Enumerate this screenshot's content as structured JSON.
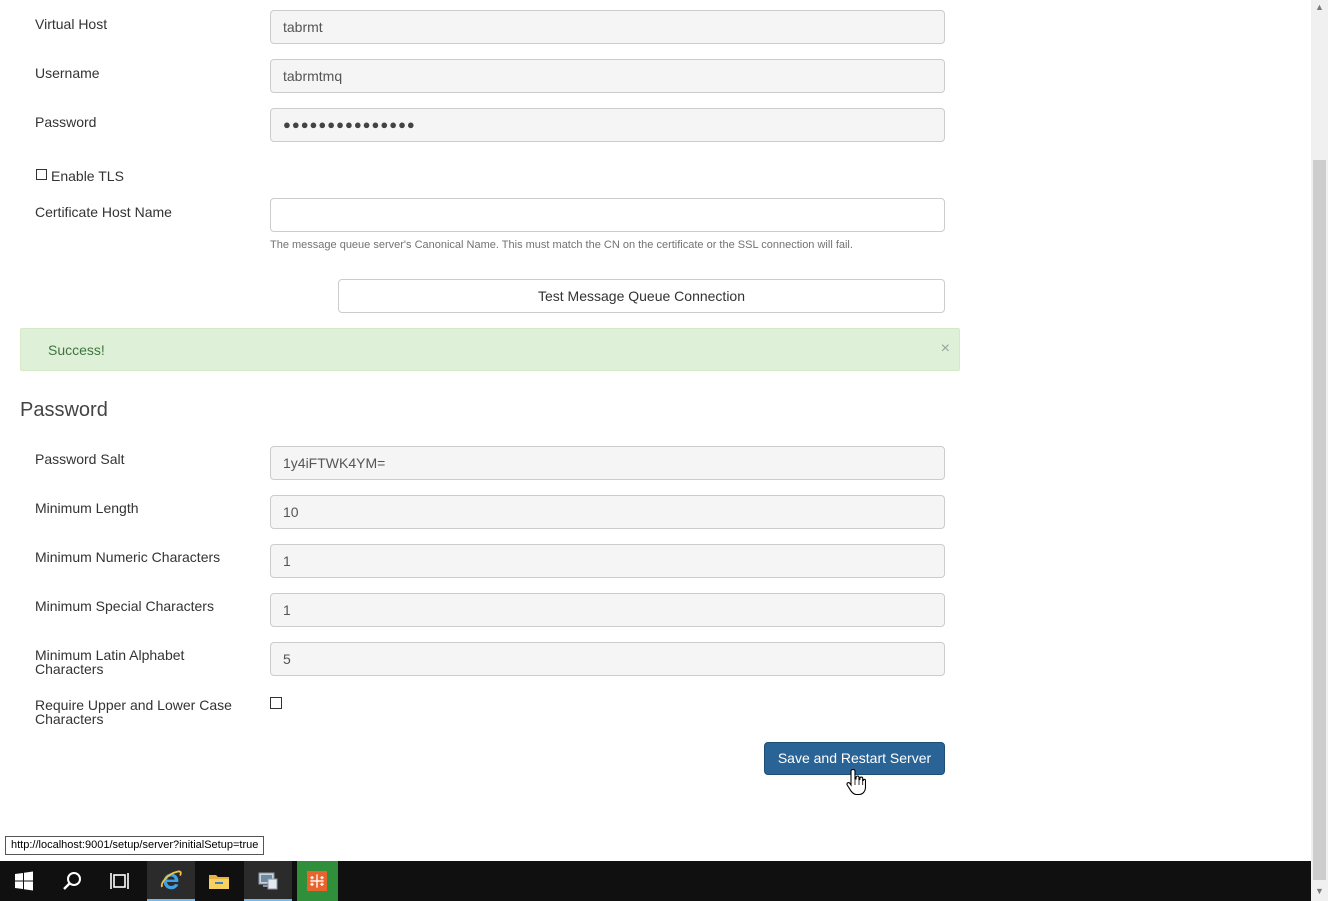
{
  "form": {
    "virtual_host": {
      "label": "Virtual Host",
      "value": "tabrmt"
    },
    "username": {
      "label": "Username",
      "value": "tabrmtmq"
    },
    "password": {
      "label": "Password",
      "value": "●●●●●●●●●●●●●●●"
    },
    "enable_tls": {
      "label": "Enable TLS",
      "checked": false
    },
    "certificate_host_name": {
      "label": "Certificate Host Name",
      "value": "",
      "help": "The message queue server's Canonical Name. This must match the CN on the certificate or the SSL connection will fail."
    },
    "test_button": "Test Message Queue Connection"
  },
  "alert": {
    "text": "Success!",
    "close": "×",
    "color": "#dff0d8"
  },
  "password_section": {
    "title": "Password",
    "salt": {
      "label": "Password Salt",
      "value": "1y4iFTWK4YM="
    },
    "min_length": {
      "label": "Minimum Length",
      "value": "10"
    },
    "min_numeric": {
      "label": "Minimum Numeric Characters",
      "value": "1"
    },
    "min_special": {
      "label": "Minimum Special Characters",
      "value": "1"
    },
    "min_latin": {
      "label_line1": "Minimum Latin Alphabet",
      "label_line2": "Characters",
      "value": "5"
    },
    "require_case": {
      "label_line1": "Require Upper and Lower Case",
      "label_line2": "Characters",
      "checked": false
    }
  },
  "save_button": {
    "label": "Save and Restart Server",
    "color": "#2a6496"
  },
  "status_bar": {
    "url": "http://localhost:9001/setup/server?initialSetup=true"
  },
  "taskbar": {
    "items": [
      "windows-start-icon",
      "search-icon",
      "task-view-icon",
      "internet-explorer-icon",
      "file-explorer-icon",
      "server-manager-icon",
      "tableau-icon"
    ]
  }
}
